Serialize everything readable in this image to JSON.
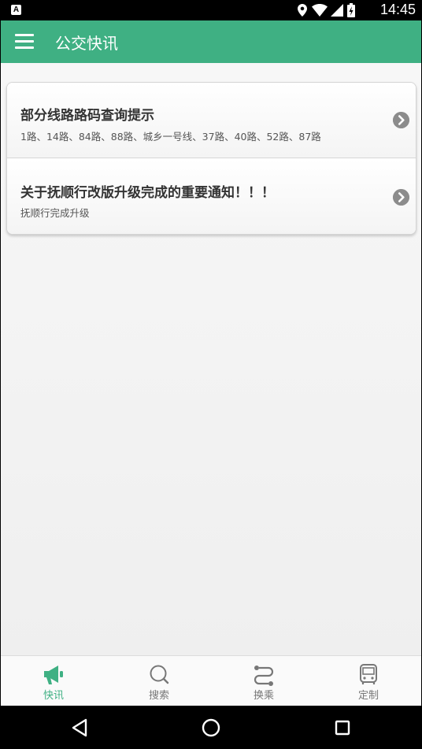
{
  "status_bar": {
    "notification_icon": "A",
    "time": "14:45",
    "icons": [
      "location-icon",
      "wifi-icon",
      "signal-icon",
      "battery-icon"
    ]
  },
  "app_bar": {
    "title": "公交快讯",
    "menu_icon": "hamburger-icon"
  },
  "news": [
    {
      "title": "部分线路路码查询提示",
      "subtitle": "1路、14路、84路、88路、城乡一号线、37路、40路、52路、87路"
    },
    {
      "title": "关于抚顺行改版升级完成的重要通知！！！",
      "subtitle": "抚顺行完成升级"
    }
  ],
  "tabs": [
    {
      "label": "快讯",
      "icon": "megaphone-icon",
      "active": true
    },
    {
      "label": "搜索",
      "icon": "search-icon",
      "active": false
    },
    {
      "label": "换乘",
      "icon": "route-icon",
      "active": false
    },
    {
      "label": "定制",
      "icon": "bus-icon",
      "active": false
    }
  ],
  "colors": {
    "primary": "#3fb083",
    "tab_inactive": "#777777",
    "title_text": "#333333"
  },
  "nav_bar": {
    "buttons": [
      "back-icon",
      "home-icon",
      "recents-icon"
    ]
  }
}
